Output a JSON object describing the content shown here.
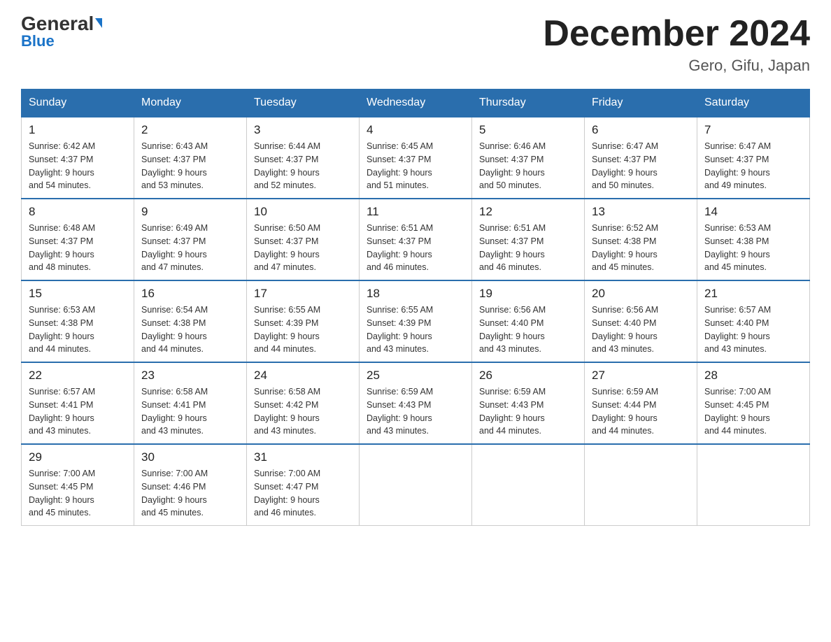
{
  "header": {
    "logo_general": "General",
    "logo_blue": "Blue",
    "month_title": "December 2024",
    "location": "Gero, Gifu, Japan"
  },
  "days_of_week": [
    "Sunday",
    "Monday",
    "Tuesday",
    "Wednesday",
    "Thursday",
    "Friday",
    "Saturday"
  ],
  "weeks": [
    [
      {
        "day": "1",
        "sunrise": "6:42 AM",
        "sunset": "4:37 PM",
        "daylight": "9 hours and 54 minutes."
      },
      {
        "day": "2",
        "sunrise": "6:43 AM",
        "sunset": "4:37 PM",
        "daylight": "9 hours and 53 minutes."
      },
      {
        "day": "3",
        "sunrise": "6:44 AM",
        "sunset": "4:37 PM",
        "daylight": "9 hours and 52 minutes."
      },
      {
        "day": "4",
        "sunrise": "6:45 AM",
        "sunset": "4:37 PM",
        "daylight": "9 hours and 51 minutes."
      },
      {
        "day": "5",
        "sunrise": "6:46 AM",
        "sunset": "4:37 PM",
        "daylight": "9 hours and 50 minutes."
      },
      {
        "day": "6",
        "sunrise": "6:47 AM",
        "sunset": "4:37 PM",
        "daylight": "9 hours and 50 minutes."
      },
      {
        "day": "7",
        "sunrise": "6:47 AM",
        "sunset": "4:37 PM",
        "daylight": "9 hours and 49 minutes."
      }
    ],
    [
      {
        "day": "8",
        "sunrise": "6:48 AM",
        "sunset": "4:37 PM",
        "daylight": "9 hours and 48 minutes."
      },
      {
        "day": "9",
        "sunrise": "6:49 AM",
        "sunset": "4:37 PM",
        "daylight": "9 hours and 47 minutes."
      },
      {
        "day": "10",
        "sunrise": "6:50 AM",
        "sunset": "4:37 PM",
        "daylight": "9 hours and 47 minutes."
      },
      {
        "day": "11",
        "sunrise": "6:51 AM",
        "sunset": "4:37 PM",
        "daylight": "9 hours and 46 minutes."
      },
      {
        "day": "12",
        "sunrise": "6:51 AM",
        "sunset": "4:37 PM",
        "daylight": "9 hours and 46 minutes."
      },
      {
        "day": "13",
        "sunrise": "6:52 AM",
        "sunset": "4:38 PM",
        "daylight": "9 hours and 45 minutes."
      },
      {
        "day": "14",
        "sunrise": "6:53 AM",
        "sunset": "4:38 PM",
        "daylight": "9 hours and 45 minutes."
      }
    ],
    [
      {
        "day": "15",
        "sunrise": "6:53 AM",
        "sunset": "4:38 PM",
        "daylight": "9 hours and 44 minutes."
      },
      {
        "day": "16",
        "sunrise": "6:54 AM",
        "sunset": "4:38 PM",
        "daylight": "9 hours and 44 minutes."
      },
      {
        "day": "17",
        "sunrise": "6:55 AM",
        "sunset": "4:39 PM",
        "daylight": "9 hours and 44 minutes."
      },
      {
        "day": "18",
        "sunrise": "6:55 AM",
        "sunset": "4:39 PM",
        "daylight": "9 hours and 43 minutes."
      },
      {
        "day": "19",
        "sunrise": "6:56 AM",
        "sunset": "4:40 PM",
        "daylight": "9 hours and 43 minutes."
      },
      {
        "day": "20",
        "sunrise": "6:56 AM",
        "sunset": "4:40 PM",
        "daylight": "9 hours and 43 minutes."
      },
      {
        "day": "21",
        "sunrise": "6:57 AM",
        "sunset": "4:40 PM",
        "daylight": "9 hours and 43 minutes."
      }
    ],
    [
      {
        "day": "22",
        "sunrise": "6:57 AM",
        "sunset": "4:41 PM",
        "daylight": "9 hours and 43 minutes."
      },
      {
        "day": "23",
        "sunrise": "6:58 AM",
        "sunset": "4:41 PM",
        "daylight": "9 hours and 43 minutes."
      },
      {
        "day": "24",
        "sunrise": "6:58 AM",
        "sunset": "4:42 PM",
        "daylight": "9 hours and 43 minutes."
      },
      {
        "day": "25",
        "sunrise": "6:59 AM",
        "sunset": "4:43 PM",
        "daylight": "9 hours and 43 minutes."
      },
      {
        "day": "26",
        "sunrise": "6:59 AM",
        "sunset": "4:43 PM",
        "daylight": "9 hours and 44 minutes."
      },
      {
        "day": "27",
        "sunrise": "6:59 AM",
        "sunset": "4:44 PM",
        "daylight": "9 hours and 44 minutes."
      },
      {
        "day": "28",
        "sunrise": "7:00 AM",
        "sunset": "4:45 PM",
        "daylight": "9 hours and 44 minutes."
      }
    ],
    [
      {
        "day": "29",
        "sunrise": "7:00 AM",
        "sunset": "4:45 PM",
        "daylight": "9 hours and 45 minutes."
      },
      {
        "day": "30",
        "sunrise": "7:00 AM",
        "sunset": "4:46 PM",
        "daylight": "9 hours and 45 minutes."
      },
      {
        "day": "31",
        "sunrise": "7:00 AM",
        "sunset": "4:47 PM",
        "daylight": "9 hours and 46 minutes."
      },
      null,
      null,
      null,
      null
    ]
  ],
  "labels": {
    "sunrise": "Sunrise:",
    "sunset": "Sunset:",
    "daylight": "Daylight:"
  }
}
